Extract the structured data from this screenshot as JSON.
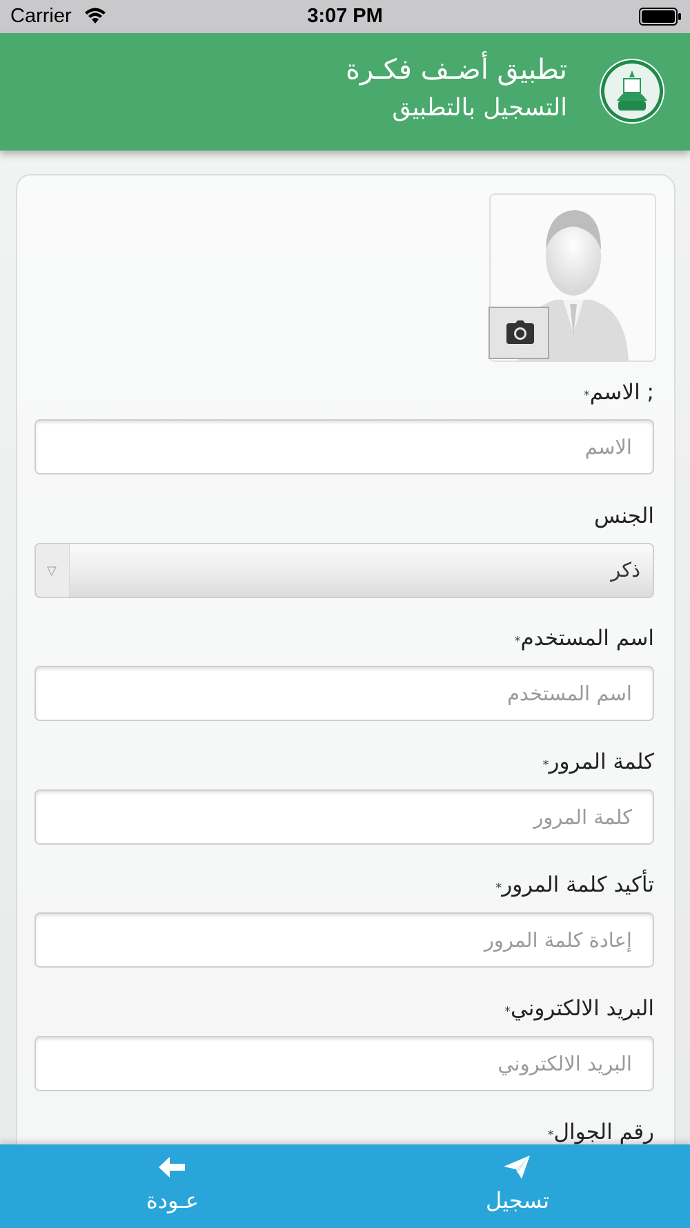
{
  "status_bar": {
    "carrier": "Carrier",
    "time": "3:07 PM",
    "icons": [
      "wifi-icon",
      "battery-icon"
    ]
  },
  "header": {
    "title": "تطبيق أضـف فكـرة",
    "subtitle": "التسجيل بالتطبيق",
    "logo_icon": "riyadh-municipality-logo",
    "color": "#4aa96c"
  },
  "form": {
    "avatar_icon": "user-placeholder-icon",
    "camera_icon": "camera-icon",
    "required_mark": "*",
    "fields": {
      "name": {
        "label": "; الاسم",
        "placeholder": "الاسم",
        "value": ""
      },
      "gender": {
        "label": "الجنس",
        "selected": "ذكر"
      },
      "username": {
        "label": "اسم المستخدم",
        "placeholder": "اسم المستخدم",
        "value": ""
      },
      "password": {
        "label": "كلمة المرور",
        "placeholder": "كلمة المرور",
        "value": ""
      },
      "confirm_password": {
        "label": "تأكيد كلمة المرور",
        "placeholder": "إعادة كلمة المرور",
        "value": ""
      },
      "email": {
        "label": "البريد الالكتروني",
        "placeholder": "البريد الالكتروني",
        "value": ""
      },
      "mobile": {
        "label": "رقم الجوال"
      }
    }
  },
  "bottom_bar": {
    "color": "#2aa5da",
    "back": {
      "label": "عـودة",
      "icon": "arrow-left-icon"
    },
    "register": {
      "label": "تسجيل",
      "icon": "send-icon"
    }
  }
}
